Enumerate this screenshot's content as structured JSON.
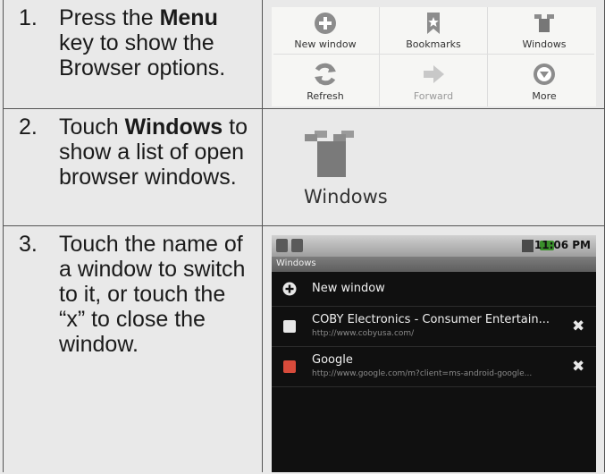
{
  "steps": [
    {
      "number": "1.",
      "pre": "Press the ",
      "bold": "Menu",
      "post": " key to show the Browser options."
    },
    {
      "number": "2.",
      "pre": "Touch ",
      "bold": "Windows",
      "post": " to show a list of open browser windows."
    },
    {
      "number": "3.",
      "text": "Touch the name of a window to switch to it, or touch the “x” to close the window."
    }
  ],
  "menu": {
    "items": [
      {
        "label": "New window",
        "icon": "plus-circle-icon"
      },
      {
        "label": "Bookmarks",
        "icon": "bookmark-star-icon"
      },
      {
        "label": "Windows",
        "icon": "windows-icon"
      },
      {
        "label": "Refresh",
        "icon": "refresh-icon"
      },
      {
        "label": "Forward",
        "icon": "forward-arrow-icon",
        "disabled": true
      },
      {
        "label": "More",
        "icon": "more-chevron-icon"
      }
    ]
  },
  "windows_icon_label": "Windows",
  "phone": {
    "status_time": "11:06 PM",
    "title": "Windows",
    "new_window_label": "New window",
    "windows": [
      {
        "title": "COBY Electronics - Consumer Entertain...",
        "url": "http://www.cobyusa.com/",
        "favicon_color": "#e8e8e8"
      },
      {
        "title": "Google",
        "url": "http://www.google.com/m?client=ms-android-google...",
        "favicon_color": "#d84b3b"
      }
    ],
    "close_glyph": "✖"
  },
  "colors": {
    "page_bg": "#e9e9e9",
    "border": "#555555",
    "phone_bg": "#101010",
    "battery": "#3a8f2b"
  }
}
